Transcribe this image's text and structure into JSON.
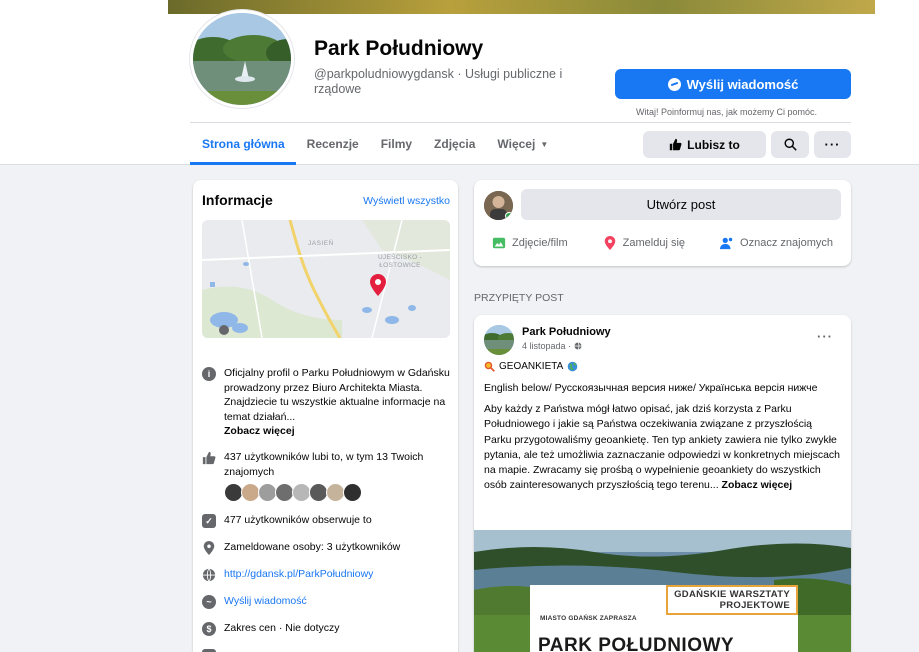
{
  "page": {
    "name": "Park Południowy",
    "subtitle": "@parkpoludniowygdansk · Usługi publiczne i rządowe"
  },
  "header": {
    "message_button": "Wyślij wiadomość",
    "message_hint": "Witaj! Poinformuj nas, jak możemy Ci pomóc.",
    "like_button": "Lubisz to"
  },
  "tabs": [
    {
      "label": "Strona główna"
    },
    {
      "label": "Recenzje"
    },
    {
      "label": "Filmy"
    },
    {
      "label": "Zdjęcia"
    },
    {
      "label": "Więcej"
    }
  ],
  "info": {
    "title": "Informacje",
    "see_all": "Wyświetl wszystko",
    "map_labels": [
      "JASIEŃ",
      "UJEŚCISKO - ŁOSTOWICE"
    ],
    "description": "Oficjalny profil o Parku Południowym w Gdańsku prowadzony przez Biuro Architekta Miasta. Znajdziecie tu wszystkie aktualne informacje na temat działań...",
    "see_more": "Zobacz więcej",
    "likes": "437 użytkowników lubi to, w tym 13 Twoich znajomych",
    "followers": "477 użytkowników obserwuje to",
    "checkins": "Zameldowane osoby: 3 użytkowników",
    "website": "http://gdansk.pl/ParkPołudniowy",
    "send_message": "Wyślij wiadomość",
    "price_range": "Zakres cen · Nie dotyczy"
  },
  "composer": {
    "create_post": "Utwórz post",
    "photo_video": "Zdjęcie/film",
    "check_in": "Zamelduj się",
    "tag_friends": "Oznacz znajomych"
  },
  "pinned": {
    "label": "PRZYPIĘTY POST",
    "author": "Park Południowy",
    "date": "4 listopada · ",
    "tag": "GEOANKIETA",
    "languages": "English below/ Русскоязычная версия ниже/ Українська версія нижче",
    "body": "Aby każdy z Państwa mógł łatwo opisać, jak dziś korzysta z Parku Południowego i jakie są Państwa oczekiwania związane z przyszłością Parku przygotowaliśmy geoankietę. Ten typ ankiety zawiera nie tylko zwykłe pytania, ale też umożliwia zaznaczanie odpowiedzi w konkretnych miejscach na mapie. Zwracamy się prośbą o wypełnienie geoankiety do wszystkich osób zainteresowanych przyszłością tego terenu...",
    "see_more": "Zobacz więcej",
    "poster": {
      "corner_line1": "GDAŃSKIE WARSZTATY",
      "corner_line2": "PROJEKTOWE",
      "small": "MIASTO GDAŃSK ZAPRASZA",
      "big": "PARK POŁUDNIOWY"
    }
  },
  "colors": {
    "accent": "#1877f2",
    "background": "#f0f2f5",
    "card": "#ffffff",
    "secondary_text": "#65676b"
  },
  "icons": [
    "messenger-icon",
    "like-icon",
    "search-icon",
    "more-icon",
    "info-icon",
    "followers-icon",
    "location-icon",
    "globe-icon",
    "photo-icon",
    "map-pin-icon",
    "tag-people-icon",
    "globe-audience-icon"
  ]
}
